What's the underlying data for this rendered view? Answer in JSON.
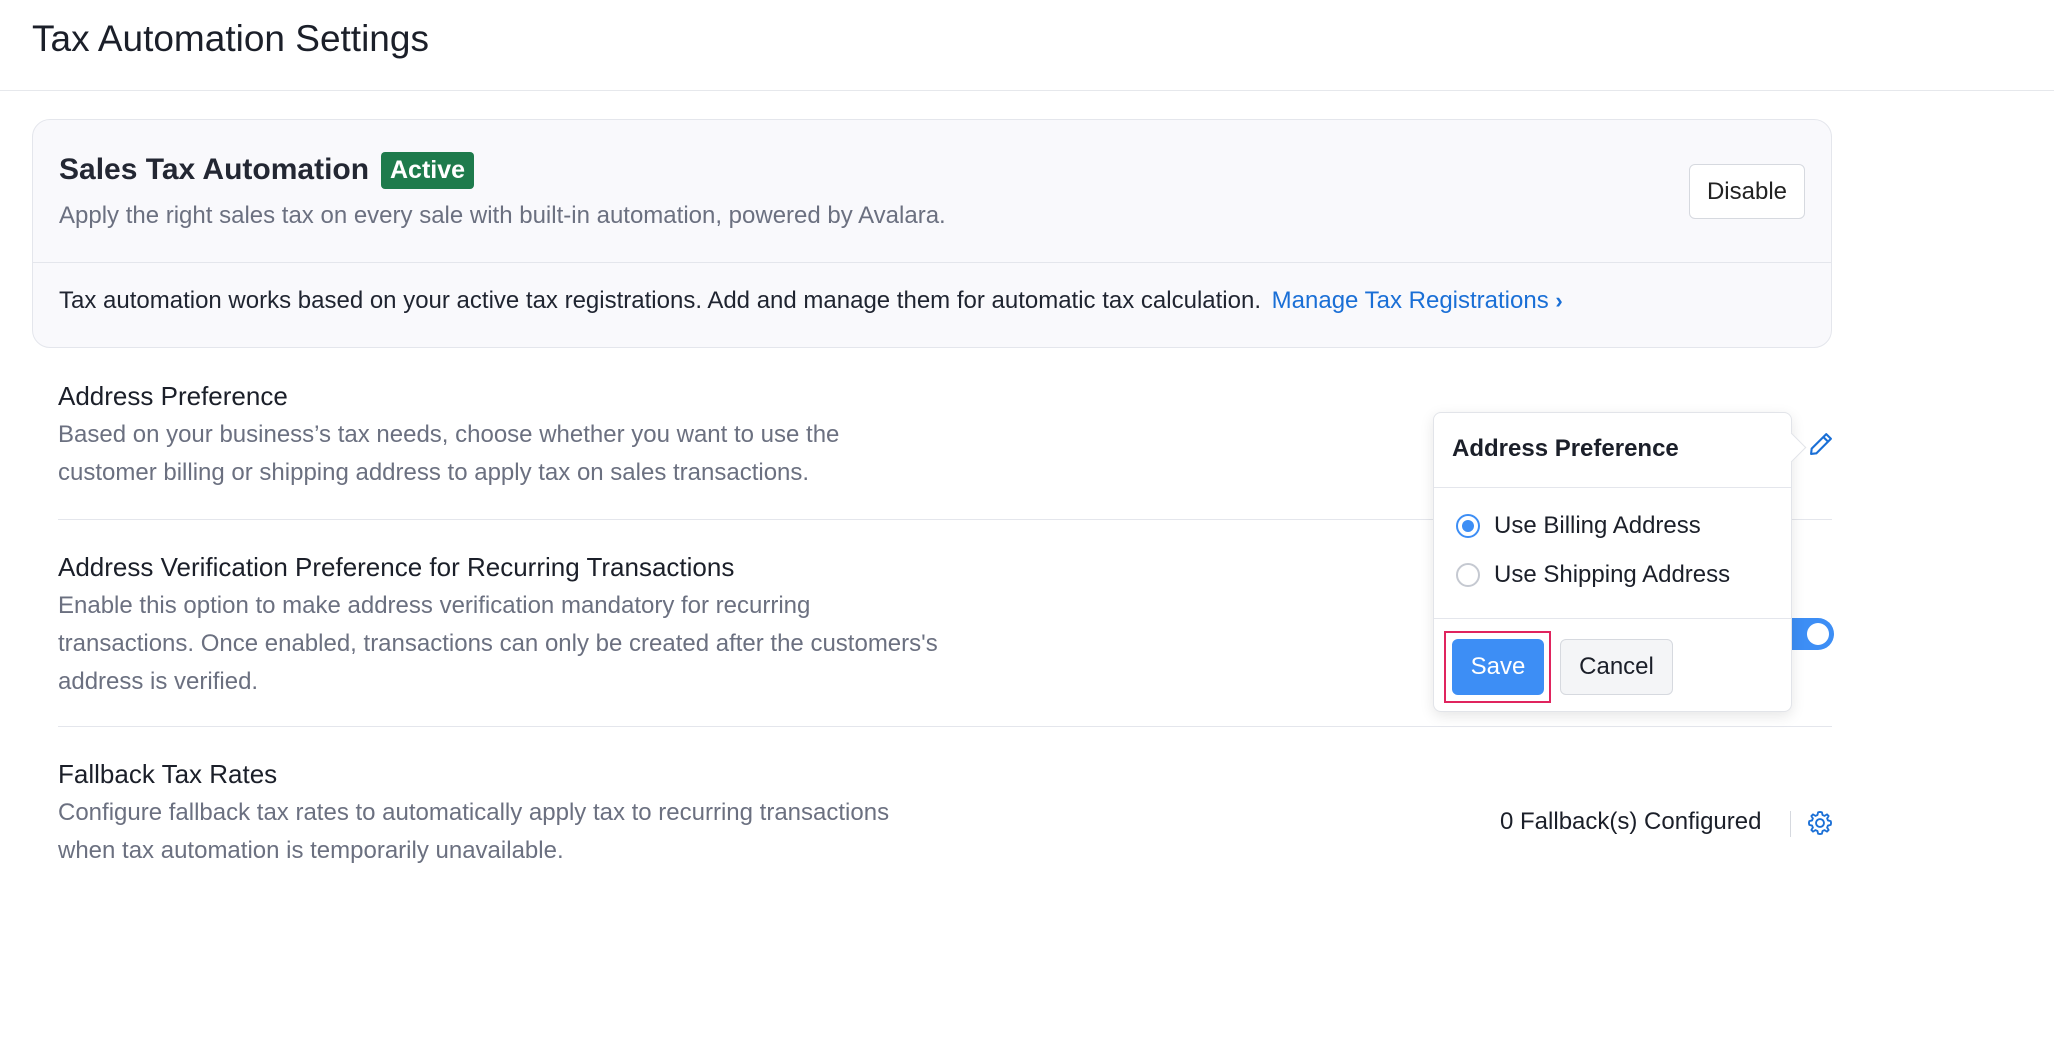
{
  "header": {
    "title": "Tax Automation Settings"
  },
  "automation": {
    "title": "Sales Tax Automation",
    "status_badge": "Active",
    "description": "Apply the right sales tax on every sale with built-in automation, powered by Avalara.",
    "disable_label": "Disable",
    "note": "Tax automation works based on your active tax registrations. Add and manage them for automatic tax calculation.",
    "manage_link": "Manage Tax Registrations",
    "manage_chevron": "›"
  },
  "settings": {
    "address_preference": {
      "title": "Address Preference",
      "description": "Based on your business’s tax needs, choose whether you want to use the customer billing or shipping address to apply tax on sales transactions.",
      "edit_icon": "pencil-icon"
    },
    "address_verification": {
      "title": "Address Verification Preference for Recurring Transactions",
      "description": "Enable this option to make address verification mandatory for recurring transactions. Once enabled, transactions can only be created after the customers's address is verified.",
      "toggle_on": true
    },
    "fallback": {
      "title": "Fallback Tax Rates",
      "description": "Configure fallback tax rates to automatically apply tax to recurring transactions when tax automation is temporarily unavailable.",
      "count_label": "0 Fallback(s) Configured",
      "settings_icon": "gear-icon"
    }
  },
  "popover": {
    "title": "Address Preference",
    "options": [
      {
        "label": "Use Billing Address",
        "checked": true
      },
      {
        "label": "Use Shipping Address",
        "checked": false
      }
    ],
    "save_label": "Save",
    "cancel_label": "Cancel"
  },
  "colors": {
    "accent": "#3d8ef5",
    "link": "#1a6fd6",
    "badge": "#1e7b4c",
    "highlight": "#e0245e"
  }
}
